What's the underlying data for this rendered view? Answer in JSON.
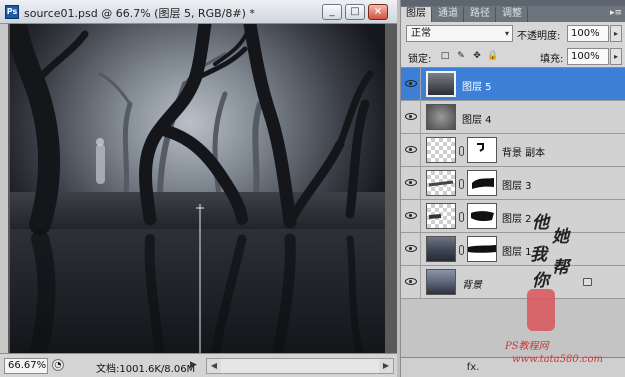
{
  "document": {
    "title": "source01.psd @ 66.7% (图层 5, RGB/8#) *",
    "app_badge": "Ps",
    "window_buttons": [
      "_",
      "□",
      "×"
    ],
    "status": {
      "zoom": "66.67%",
      "doc_info": "文档:1001.6K/8.06M",
      "menu_arrow": "▶"
    },
    "scroll_arrows": [
      "◀",
      "▶"
    ]
  },
  "panel": {
    "tabs": [
      "图层",
      "通道",
      "路径",
      "调整"
    ],
    "active_tab": "图层",
    "menu_icon": "▸≡",
    "blend_mode": "正常",
    "opacity_label": "不透明度:",
    "opacity": "100%",
    "lock_label": "锁定:",
    "lock_icons": [
      "□",
      "✎",
      "✥",
      "🔒"
    ],
    "fill_label": "填充:",
    "fill": "100%",
    "value_arrow": "▸",
    "select_arrow": "▾",
    "layers": [
      {
        "name": "图层 5",
        "selected": true,
        "thumb": "forest-dark",
        "mask": false
      },
      {
        "name": "图层 4",
        "selected": false,
        "thumb": "fog",
        "mask": false
      },
      {
        "name": "背景 副本",
        "selected": false,
        "thumb": "checker",
        "mask": true
      },
      {
        "name": "图层 3",
        "selected": false,
        "thumb": "checker",
        "mask": true
      },
      {
        "name": "图层 2",
        "selected": false,
        "thumb": "checker",
        "mask": true
      },
      {
        "name": "图层 1",
        "selected": false,
        "thumb": "forest",
        "mask": true
      },
      {
        "name": "背景",
        "selected": false,
        "thumb": "forest",
        "mask": false,
        "locked": true
      }
    ],
    "footer_icons": [
      "fx."
    ]
  },
  "watermark": {
    "chars": [
      "他",
      "她",
      "我",
      "帮",
      "你"
    ],
    "site": "PS教程网",
    "url": "www.tata580.com"
  },
  "colors": {
    "selection": "#3d7fd7",
    "tabbar": "#6c747d",
    "watermark_red": "#c73b3b"
  }
}
